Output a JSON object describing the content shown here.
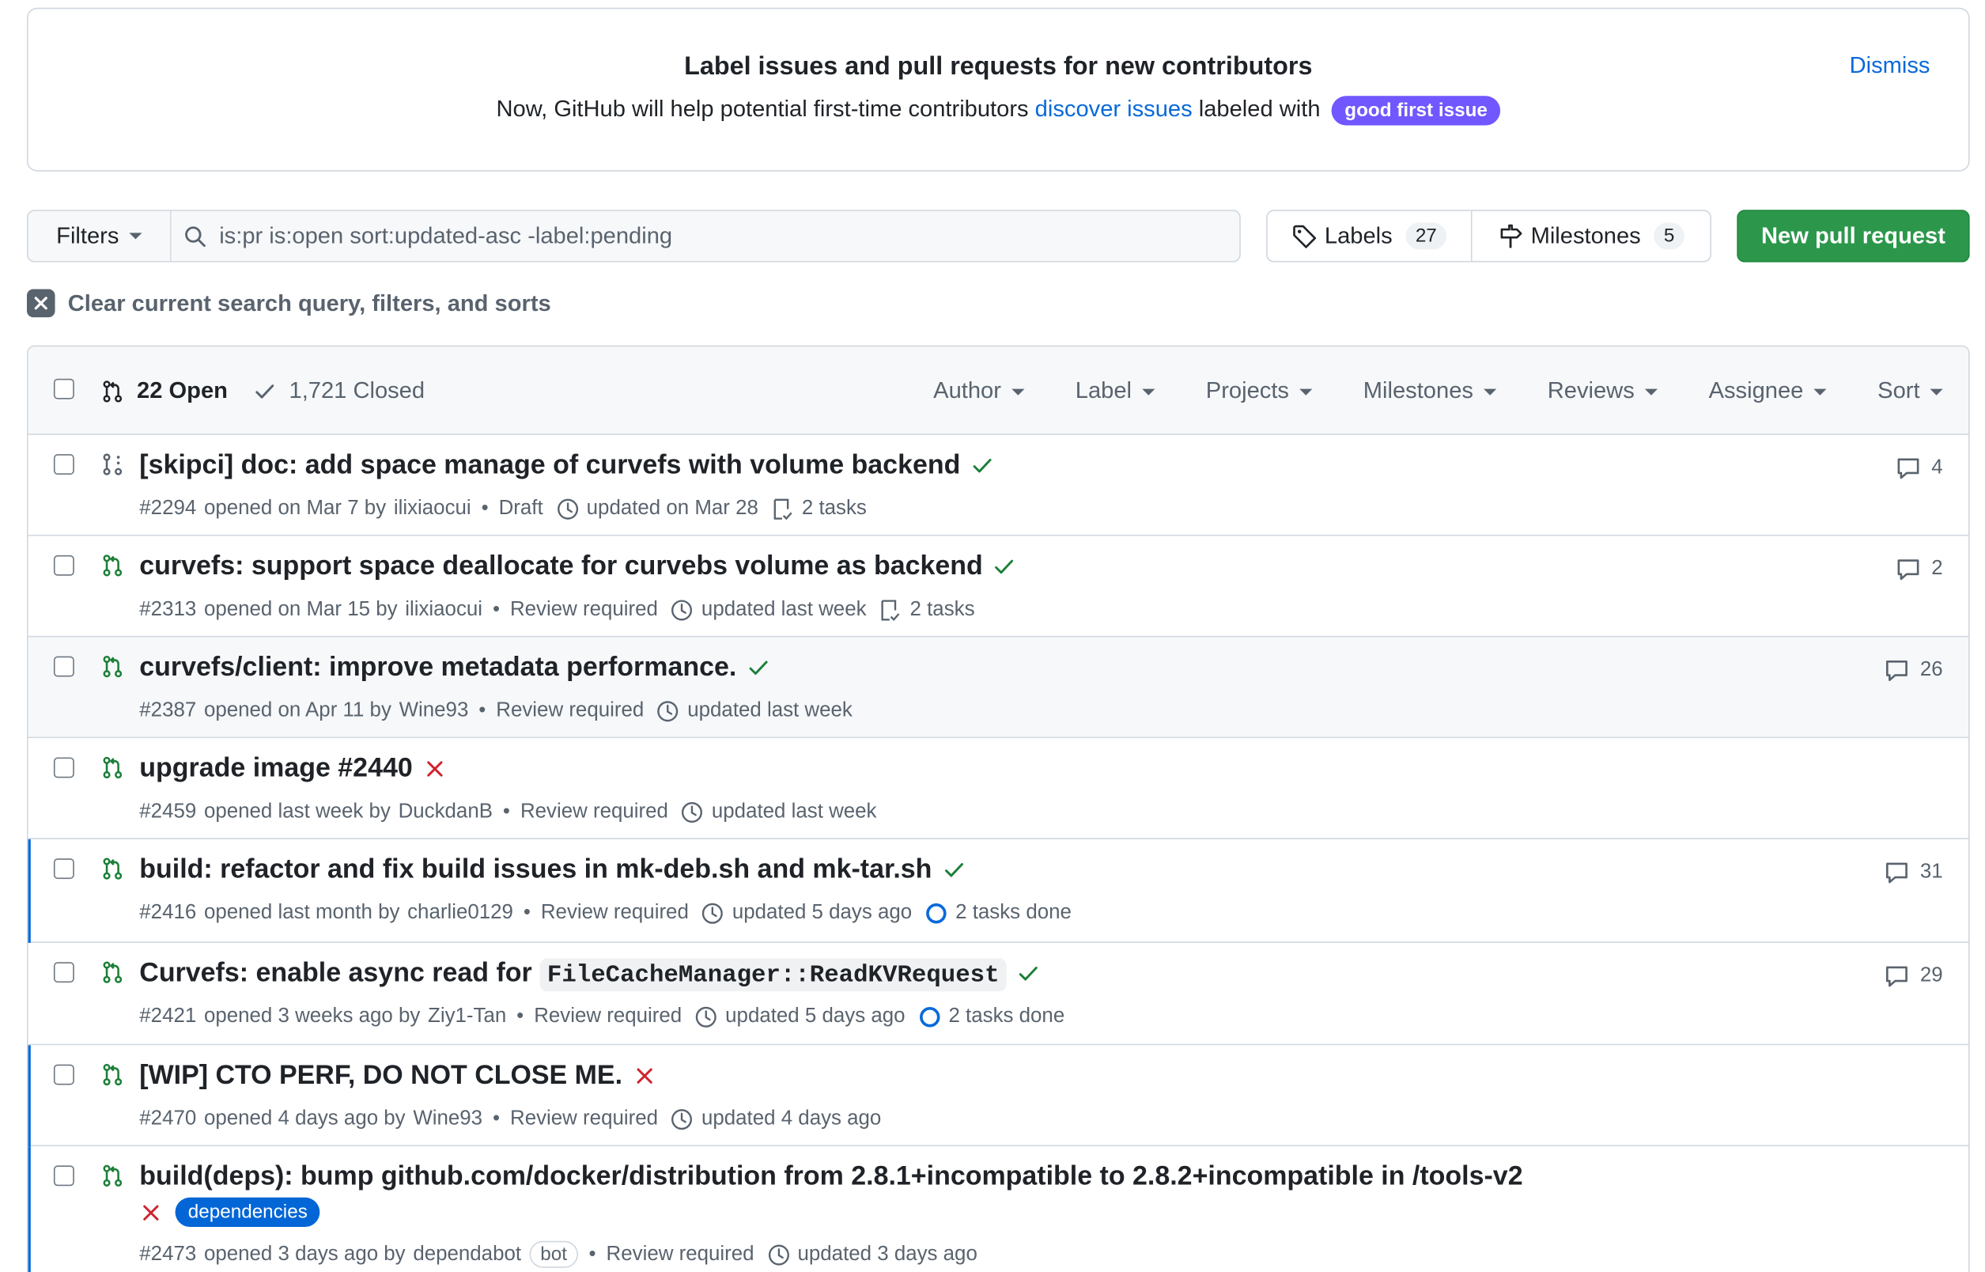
{
  "banner": {
    "title": "Label issues and pull requests for new contributors",
    "desc_prefix": "Now, GitHub will help potential first-time contributors ",
    "desc_link": "discover issues",
    "desc_suffix": " labeled with ",
    "label": "good first issue",
    "label_color": "#7057ff",
    "dismiss": "Dismiss"
  },
  "toolbar": {
    "filters_label": "Filters",
    "search_value": "is:pr is:open sort:updated-asc -label:pending",
    "labels_label": "Labels",
    "labels_count": "27",
    "milestones_label": "Milestones",
    "milestones_count": "5",
    "new_pr_label": "New pull request",
    "new_pr_color": "#2c974b"
  },
  "clear_query": "Clear current search query, filters, and sorts",
  "list_header": {
    "open": "22 Open",
    "closed": "1,721 Closed",
    "filters": [
      "Author",
      "Label",
      "Projects",
      "Milestones",
      "Reviews",
      "Assignee",
      "Sort"
    ]
  },
  "rows": [
    {
      "title": "[skipci] doc: add space manage of curvefs with volume backend",
      "number": "#2294",
      "opened": "opened on Mar 7 by",
      "author": "ilixiaocui",
      "state": "Draft",
      "updated": "updated on Mar 28",
      "tasks": "2 tasks",
      "comments": "4",
      "status": "success"
    },
    {
      "title": "curvefs: support space deallocate for curvebs volume as backend",
      "number": "#2313",
      "opened": "opened on Mar 15 by",
      "author": "ilixiaocui",
      "state": "Review required",
      "updated": "updated last week",
      "tasks": "2 tasks",
      "comments": "2",
      "status": "success"
    },
    {
      "title": "curvefs/client: improve metadata performance.",
      "number": "#2387",
      "opened": "opened on Apr 11 by",
      "author": "Wine93",
      "state": "Review required",
      "updated": "updated last week",
      "comments": "26",
      "status": "success"
    },
    {
      "title": "upgrade image #2440",
      "number": "#2459",
      "opened": "opened last week by",
      "author": "DuckdanB",
      "state": "Review required",
      "updated": "updated last week",
      "status": "failure"
    },
    {
      "title": "build: refactor and fix build issues in mk-deb.sh and mk-tar.sh",
      "number": "#2416",
      "opened": "opened last month by",
      "author": "charlie0129",
      "state": "Review required",
      "updated": "updated 5 days ago",
      "tasks": "2 tasks done",
      "comments": "31",
      "status": "success"
    },
    {
      "title_prefix": "Curvefs: enable async read for ",
      "title_code": "FileCacheManager::ReadKVRequest",
      "number": "#2421",
      "opened": "opened 3 weeks ago by",
      "author": "Ziy1-Tan",
      "state": "Review required",
      "updated": "updated 5 days ago",
      "tasks": "2 tasks done",
      "comments": "29",
      "status": "success"
    },
    {
      "title": "[WIP] CTO PERF, DO NOT CLOSE ME.",
      "number": "#2470",
      "opened": "opened 4 days ago by",
      "author": "Wine93",
      "state": "Review required",
      "updated": "updated 4 days ago",
      "status": "failure"
    },
    {
      "title": "build(deps): bump github.com/docker/distribution from 2.8.1+incompatible to 2.8.2+incompatible in /tools-v2",
      "label": "dependencies",
      "number": "#2473",
      "opened": "opened 3 days ago by",
      "author": "dependabot",
      "bot": "bot",
      "state": "Review required",
      "updated": "updated 3 days ago",
      "status": "failure"
    }
  ]
}
